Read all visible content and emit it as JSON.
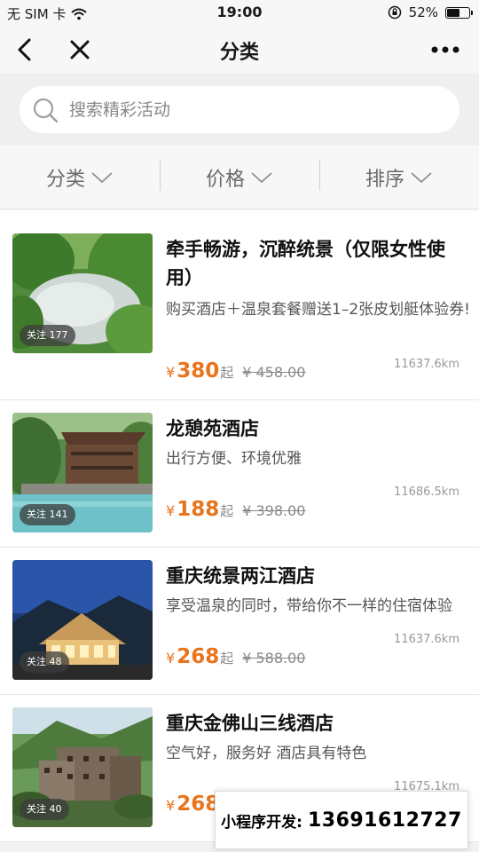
{
  "status_bar": {
    "carrier": "无 SIM 卡",
    "time": "19:00",
    "battery": "52%",
    "battery_level": 0.52
  },
  "nav": {
    "title": "分类"
  },
  "search": {
    "placeholder": "搜索精彩活动"
  },
  "filters": [
    {
      "label": "分类"
    },
    {
      "label": "价格"
    },
    {
      "label": "排序"
    }
  ],
  "items": [
    {
      "title": "牵手畅游，沉醉统景（仅限女性使用）",
      "desc": "购买酒店＋温泉套餐赠送1–2张皮划艇体验券!",
      "follow": "关注 177",
      "currency": "¥",
      "price": "380",
      "price_suffix": "起",
      "original_price": "¥ 458.00",
      "distance": "11637.6km"
    },
    {
      "title": "龙憩苑酒店",
      "desc": "出行方便、环境优雅",
      "follow": "关注 141",
      "currency": "¥",
      "price": "188",
      "price_suffix": "起",
      "original_price": "¥ 398.00",
      "distance": "11686.5km"
    },
    {
      "title": "重庆统景两江酒店",
      "desc": "享受温泉的同时，带给你不一样的住宿体验",
      "follow": "关注 48",
      "currency": "¥",
      "price": "268",
      "price_suffix": "起",
      "original_price": "¥ 588.00",
      "distance": "11637.6km"
    },
    {
      "title": "重庆金佛山三线酒店",
      "desc": "空气好，服务好 酒店具有特色",
      "follow": "关注 40",
      "currency": "¥",
      "price": "268",
      "price_suffix": "",
      "original_price": "",
      "distance": "11675.1km"
    }
  ],
  "banner": {
    "label": "小程序开发:",
    "phone": "13691612727"
  },
  "colors": {
    "price": "#e8741c",
    "background": "#f2f2f2"
  }
}
